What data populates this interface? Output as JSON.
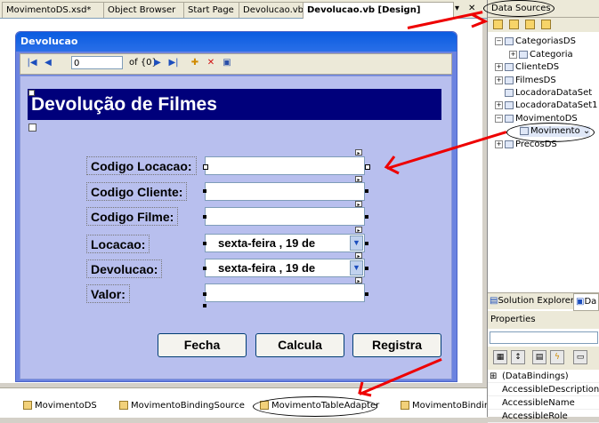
{
  "tabs": [
    {
      "label": "MovimentoDS.xsd*",
      "active": false
    },
    {
      "label": "Object Browser",
      "active": false
    },
    {
      "label": "Start Page",
      "active": false
    },
    {
      "label": "Devolucao.vb",
      "active": false
    },
    {
      "label": "Devolucao.vb [Design]",
      "active": true
    }
  ],
  "tab_controls": {
    "dropdown": "▾",
    "close": "✕"
  },
  "form": {
    "title": "Devolucao",
    "navigator": {
      "position": "0",
      "count": "of {0}"
    },
    "heading": "Devolução de Filmes",
    "fields": [
      {
        "label": "Codigo Locacao:",
        "kind": "text",
        "value": ""
      },
      {
        "label": "Codigo Cliente:",
        "kind": "text",
        "value": ""
      },
      {
        "label": "Codigo Filme:",
        "kind": "text",
        "value": ""
      },
      {
        "label": "Locacao:",
        "kind": "date",
        "value": "sexta-feira  , 19 de"
      },
      {
        "label": "Devolucao:",
        "kind": "date",
        "value": "sexta-feira  , 19 de"
      },
      {
        "label": "Valor:",
        "kind": "text",
        "value": ""
      }
    ],
    "buttons": {
      "fecha": "Fecha",
      "calcula": "Calcula",
      "registra": "Registra"
    }
  },
  "tray": [
    "MovimentoDS",
    "MovimentoBindingSource",
    "MovimentoTableAdapter",
    "MovimentoBinding"
  ],
  "data_sources": {
    "title": "Data Sources",
    "tree": [
      {
        "label": "CategoriasDS",
        "expander": "−"
      },
      {
        "label": "Categoria",
        "expander": "+"
      },
      {
        "label": "ClienteDS",
        "expander": "+"
      },
      {
        "label": "FilmesDS",
        "expander": "+"
      },
      {
        "label": "LocadoraDataSet",
        "expander": ""
      },
      {
        "label": "LocadoraDataSet1",
        "expander": "+"
      },
      {
        "label": "MovimentoDS",
        "expander": "−"
      },
      {
        "label": "Movimento",
        "expander": ""
      },
      {
        "label": "PrecosDS",
        "expander": "+"
      }
    ]
  },
  "bottom_tabs": {
    "solution_explorer": "Solution Explorer",
    "data": "Da"
  },
  "properties": {
    "title": "Properties",
    "rows": [
      {
        "expander": "⊞",
        "name": "(DataBindings)"
      },
      {
        "expander": "",
        "name": "AccessibleDescription"
      },
      {
        "expander": "",
        "name": "AccessibleName"
      },
      {
        "expander": "",
        "name": "AccessibleRole"
      }
    ]
  },
  "colors": {
    "annotation": "#e00000",
    "form_title": "#0a5ce0",
    "heading_bg": "#00007b"
  }
}
